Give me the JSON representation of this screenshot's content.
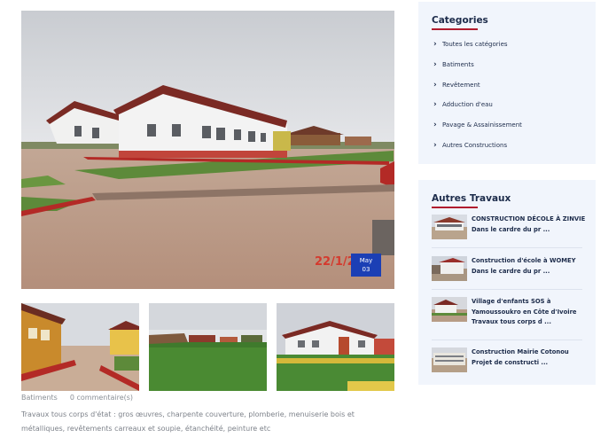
{
  "post": {
    "date_month": "May",
    "date_day": "03",
    "photo_timestamp": "22/1/2",
    "category": "Batiments",
    "comments": "0 commentaire(s)",
    "excerpt": "Travaux tous corps d'état : gros œuvres, charpente couverture, plomberie, menuiserie bois et métalliques, revêtements carreaux et soupie, étanchéité, peinture etc"
  },
  "sidebar": {
    "categories": {
      "title": "Categories",
      "items": [
        {
          "label": "Toutes les catégories"
        },
        {
          "label": "Batiments"
        },
        {
          "label": "Revêtement"
        },
        {
          "label": "Adduction d'eau"
        },
        {
          "label": "Pavage & Assainissement"
        },
        {
          "label": "Autres Constructions"
        }
      ]
    },
    "works": {
      "title": "Autres Travaux",
      "items": [
        {
          "line1": "CONSTRUCTION DÉCOLE À ZINVIE",
          "line2": "Dans le cardre du pr ..."
        },
        {
          "line1": "Construction d'école à WOMEY",
          "line2": "Dans le cardre du pr ..."
        },
        {
          "line1": "Village d'enfants SOS à",
          "line2": "Yamoussoukro en Côte d'Ivoire",
          "line3": "Travaux tous corps d ..."
        },
        {
          "line1": "Construction Mairie Cotonou",
          "line2": "Projet de constructi ..."
        }
      ]
    }
  },
  "colors": {
    "accent_red": "#b01c2e",
    "badge_blue": "#1b3fb5",
    "navy_text": "#1c2b4a",
    "widget_bg": "#f1f5fc"
  },
  "icons": {
    "category_bullet": "chevron-right-icon"
  }
}
